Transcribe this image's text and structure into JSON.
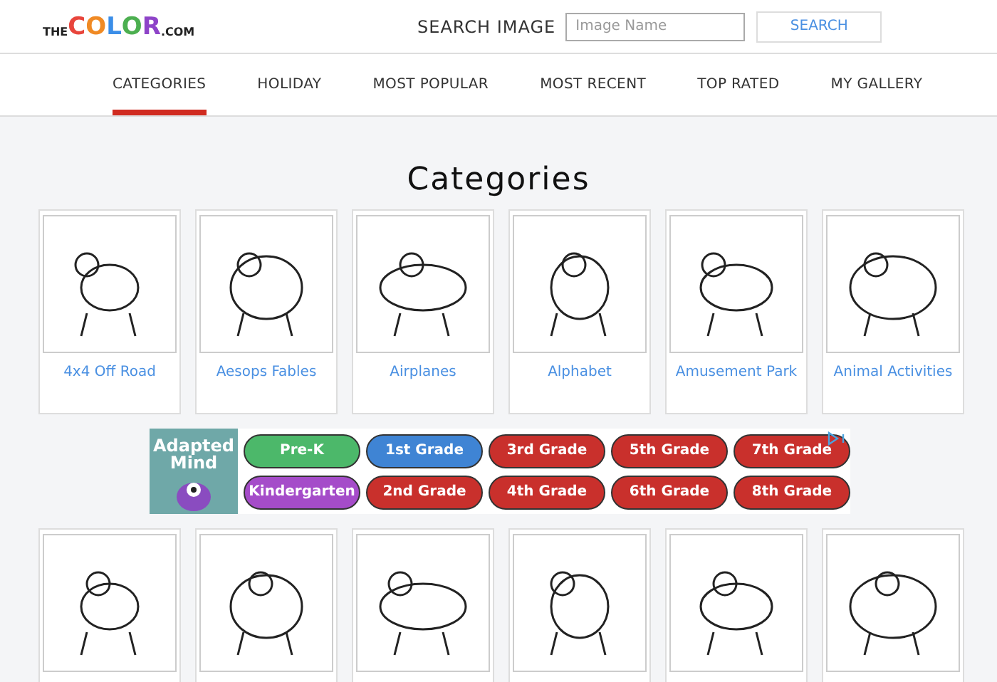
{
  "logo": {
    "prefix": "THE",
    "letters": [
      {
        "char": "C",
        "color": "#e8453c"
      },
      {
        "char": "O",
        "color": "#f08a24"
      },
      {
        "char": "L",
        "color": "#3b8ee8"
      },
      {
        "char": "O",
        "color": "#4caf50"
      },
      {
        "char": "R",
        "color": "#8e44c8"
      }
    ],
    "suffix": ".COM"
  },
  "search": {
    "label": "SEARCH IMAGE",
    "placeholder": "Image Name",
    "button": "SEARCH"
  },
  "tabs": [
    {
      "label": "CATEGORIES",
      "selected": true
    },
    {
      "label": "HOLIDAY",
      "selected": false
    },
    {
      "label": "MOST POPULAR",
      "selected": false
    },
    {
      "label": "MOST RECENT",
      "selected": false
    },
    {
      "label": "TOP RATED",
      "selected": false
    },
    {
      "label": "MY GALLERY",
      "selected": false
    }
  ],
  "heading": "Categories",
  "cards_top": [
    {
      "kind": "labeled",
      "name": "4x4 Off Road"
    },
    {
      "kind": "labeled",
      "name": "Aesops Fables"
    },
    {
      "kind": "labeled",
      "name": "Airplanes"
    },
    {
      "kind": "labeled",
      "name": "Alphabet"
    },
    {
      "kind": "labeled",
      "name": "Amusement Park"
    },
    {
      "kind": "labeled",
      "name": "Animal Activities"
    }
  ],
  "ad": {
    "logo": "Adapted Mind",
    "buttons": [
      {
        "label": "Pre-K",
        "color": "#4cb86a"
      },
      {
        "label": "1st Grade",
        "color": "#3f84d4"
      },
      {
        "label": "3rd Grade",
        "color": "#c9302c"
      },
      {
        "label": "5th Grade",
        "color": "#c9302c"
      },
      {
        "label": "7th Grade",
        "color": "#c9302c"
      },
      {
        "label": "Kindergarten",
        "color": "#a54cc9"
      },
      {
        "label": "2nd Grade",
        "color": "#c9302c"
      },
      {
        "label": "4th Grade",
        "color": "#c9302c"
      },
      {
        "label": "6th Grade",
        "color": "#c9302c"
      },
      {
        "label": "8th Grade",
        "color": "#c9302c"
      }
    ]
  },
  "cards_bottom": [
    {
      "kind": "picture-only"
    },
    {
      "kind": "picture-only"
    },
    {
      "kind": "picture-only"
    },
    {
      "kind": "picture-only"
    },
    {
      "kind": "picture-only"
    },
    {
      "kind": "picture-only"
    }
  ]
}
